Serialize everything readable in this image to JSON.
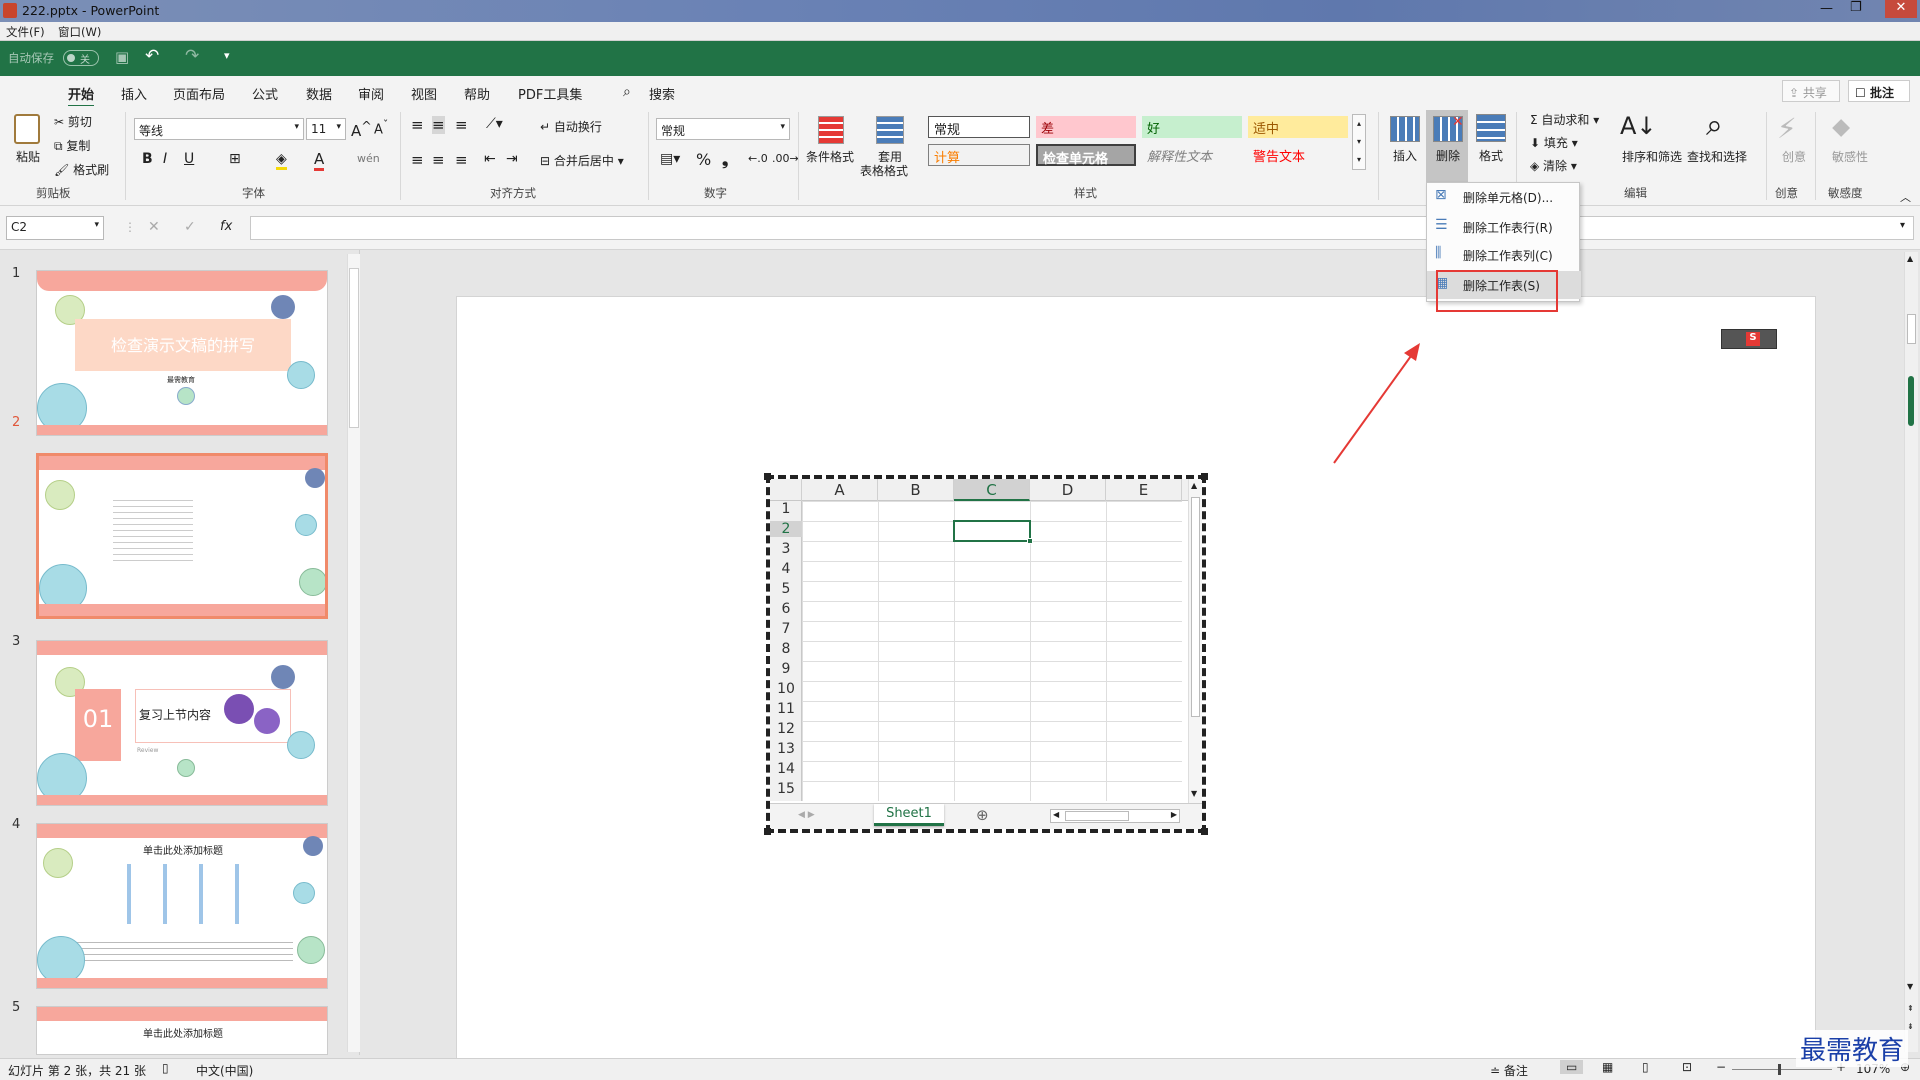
{
  "window": {
    "title": "222.pptx - PowerPoint"
  },
  "menu": {
    "file": "文件(F)",
    "window": "窗口(W)"
  },
  "qat": {
    "autosave": "自动保存",
    "toggle": "关"
  },
  "tabs": [
    "开始",
    "插入",
    "页面布局",
    "公式",
    "数据",
    "审阅",
    "视图",
    "帮助",
    "PDF工具集"
  ],
  "search": "搜索",
  "share": "共享",
  "comment": "批注",
  "clipboard": {
    "paste": "粘贴",
    "cut": "剪切",
    "copy": "复制",
    "format_painter": "格式刷",
    "group": "剪贴板"
  },
  "font": {
    "name": "等线",
    "size": "11",
    "bold": "B",
    "italic": "I",
    "underline": "U",
    "group": "字体"
  },
  "align": {
    "wrap": "自动换行",
    "merge": "合并后居中",
    "group": "对齐方式"
  },
  "number": {
    "format": "常规",
    "percent": "%",
    "group": "数字"
  },
  "styles": {
    "cond": "条件格式",
    "table": "套用",
    "table2": "表格格式",
    "normal": "常规",
    "bad": "差",
    "good": "好",
    "neutral": "适中",
    "calc": "计算",
    "check": "检查单元格",
    "explanatory": "解释性文本",
    "warning": "警告文本",
    "group": "样式"
  },
  "cells": {
    "insert": "插入",
    "delete": "删除",
    "format": "格式"
  },
  "editing": {
    "autosum": "自动求和",
    "fill": "填充",
    "clear": "清除",
    "sort": "排序和筛选",
    "find": "查找和选择",
    "group": "编辑"
  },
  "creative": {
    "label": "创意",
    "btn": "创意"
  },
  "sensitivity": {
    "label": "敏感度",
    "btn": "敏感性"
  },
  "dropdown": {
    "items": [
      "删除单元格(D)...",
      "删除工作表行(R)",
      "删除工作表列(C)",
      "删除工作表(S)"
    ]
  },
  "namebox": "C2",
  "fx": "fx",
  "thumbs": {
    "nums": [
      "1",
      "2",
      "3",
      "4",
      "5"
    ],
    "t1": "检查演示文稿的拼写",
    "t1sub": "最需教育",
    "t3num": "01",
    "t3": "复习上节内容",
    "t3sub": "Review",
    "t4": "单击此处添加标题",
    "t5": "单击此处添加标题"
  },
  "sheet": {
    "cols": [
      "A",
      "B",
      "C",
      "D",
      "E"
    ],
    "rows": [
      "1",
      "2",
      "3",
      "4",
      "5",
      "6",
      "7",
      "8",
      "9",
      "10",
      "11",
      "12",
      "13",
      "14",
      "15"
    ],
    "tab": "Sheet1"
  },
  "status": {
    "slide": "幻灯片 第 2 张，共 21 张",
    "lang": "中文(中国)",
    "notes": "备注",
    "zoom": "107%"
  },
  "watermark": "最需教育",
  "colors": {
    "green": "#217346",
    "accent_red": "#e53935",
    "scallop": "#f7a79c"
  }
}
